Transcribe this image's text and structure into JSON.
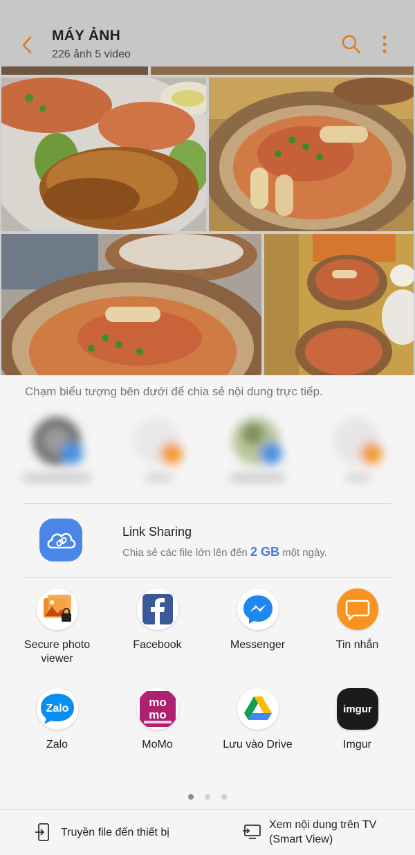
{
  "header": {
    "title": "MÁY ẢNH",
    "subtitle": "226 ảnh  5 video",
    "icons": {
      "back": "back-arrow-icon",
      "search": "search-icon",
      "more": "more-vert-icon"
    },
    "accent_color": "#e07a1f"
  },
  "gallery": {
    "photos": [
      "crab-photo-1",
      "crab-photo-2",
      "crab-photo-3",
      "crab-photo-4"
    ]
  },
  "share": {
    "hint": "Chạm biểu tượng bên dưới để chia sẻ nội dung trực tiếp.",
    "link_sharing": {
      "title": "Link Sharing",
      "desc_before": "Chia sẻ các file lớn lên đến ",
      "desc_size": "2 GB",
      "desc_after": " một ngày.",
      "icon": "cloud-link-icon",
      "color": "#3f7be0"
    },
    "apps": [
      {
        "label": "Secure photo viewer",
        "icon": "secure-photo-icon"
      },
      {
        "label": "Facebook",
        "icon": "facebook-icon"
      },
      {
        "label": "Messenger",
        "icon": "messenger-icon"
      },
      {
        "label": "Tin nhắn",
        "icon": "messages-icon"
      },
      {
        "label": "Zalo",
        "icon": "zalo-icon"
      },
      {
        "label": "MoMo",
        "icon": "momo-icon"
      },
      {
        "label": "Lưu vào Drive",
        "icon": "drive-icon"
      },
      {
        "label": "Imgur",
        "icon": "imgur-icon"
      }
    ],
    "pagination": {
      "pages": 3,
      "current": 1
    },
    "bottom": {
      "transfer_label": "Truyền file đến thiết bị",
      "smartview_line1": "Xem nội dung trên TV",
      "smartview_line2": "(Smart View)"
    }
  }
}
